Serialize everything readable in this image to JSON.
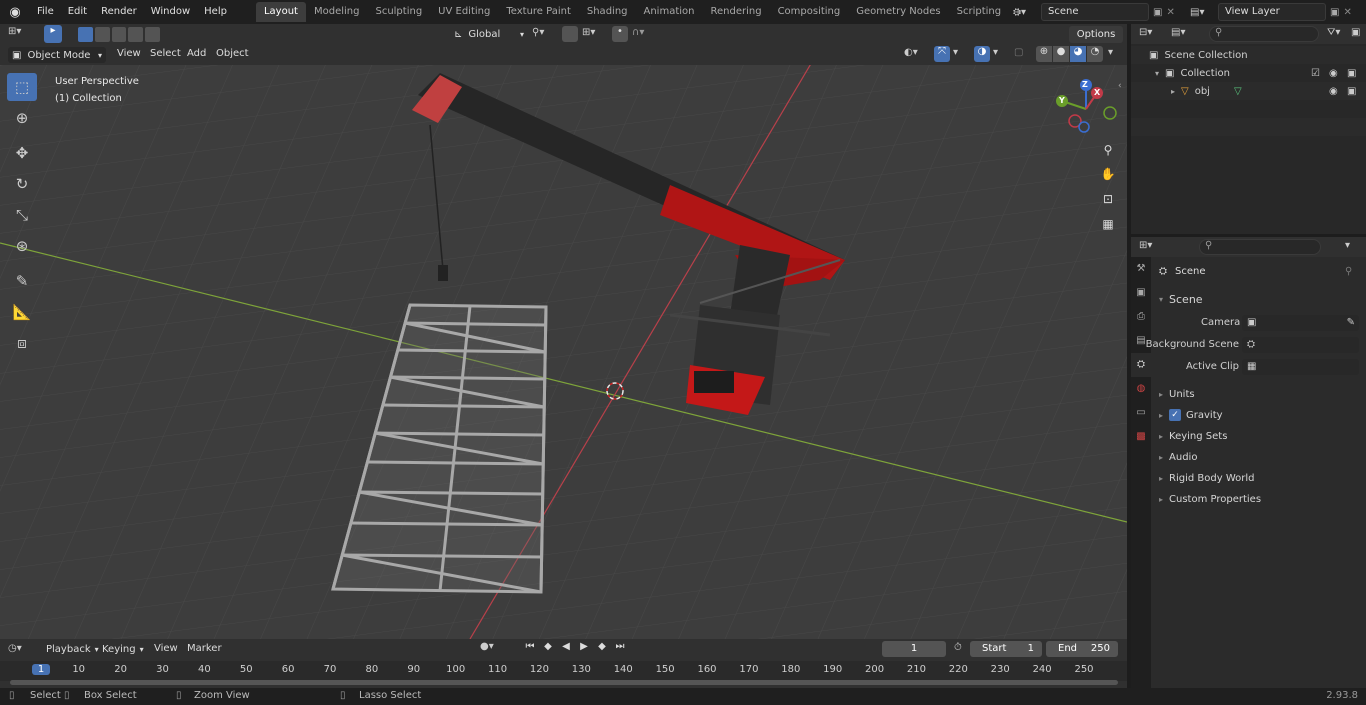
{
  "app": {
    "logo": "blender-icon"
  },
  "menu": [
    "File",
    "Edit",
    "Render",
    "Window",
    "Help"
  ],
  "workspaces": [
    "Layout",
    "Modeling",
    "Sculpting",
    "UV Editing",
    "Texture Paint",
    "Shading",
    "Animation",
    "Rendering",
    "Compositing",
    "Geometry Nodes",
    "Scripting"
  ],
  "active_workspace": "Layout",
  "scene_field": "Scene",
  "view_layer_field": "View Layer",
  "viewport": {
    "mode": "Object Mode",
    "menus": [
      "View",
      "Select",
      "Add",
      "Object"
    ],
    "transform": "Global",
    "options": "Options",
    "overlay_line1": "User Perspective",
    "overlay_line2": "(1) Collection",
    "gizmo_axes": [
      "X",
      "Y",
      "Z"
    ]
  },
  "outliner": {
    "root": "Scene Collection",
    "collection": "Collection",
    "object": "obj"
  },
  "properties": {
    "header": "Scene",
    "panel": "Scene",
    "fields": [
      {
        "label": "Camera",
        "value": ""
      },
      {
        "label": "Background Scene",
        "value": ""
      },
      {
        "label": "Active Clip",
        "value": ""
      }
    ],
    "sections": [
      "Units",
      "Gravity",
      "Keying Sets",
      "Audio",
      "Rigid Body World",
      "Custom Properties"
    ]
  },
  "timeline": {
    "menus": [
      "Playback",
      "Keying",
      "View",
      "Marker"
    ],
    "current_frame": "1",
    "start_label": "Start",
    "start": "1",
    "end_label": "End",
    "end": "250",
    "ticks": [
      "1",
      "10",
      "20",
      "30",
      "40",
      "50",
      "60",
      "70",
      "80",
      "90",
      "100",
      "110",
      "120",
      "130",
      "140",
      "150",
      "160",
      "170",
      "180",
      "190",
      "200",
      "210",
      "220",
      "230",
      "240",
      "250"
    ]
  },
  "status": {
    "items": [
      "Select",
      "Box Select",
      "Zoom View",
      "Lasso Select"
    ],
    "version": "2.93.8"
  }
}
